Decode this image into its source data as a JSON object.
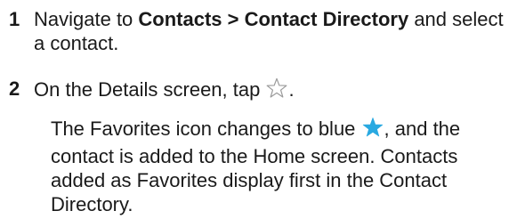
{
  "steps": [
    {
      "number": "1",
      "text_before": "Navigate to ",
      "bold_text": "Contacts > Contact Directory",
      "text_after": " and select a contact."
    },
    {
      "number": "2",
      "text_before": "On the Details screen, tap ",
      "text_after": "."
    }
  ],
  "note": {
    "text_before": "The Favorites icon changes to blue ",
    "text_after": ", and the contact is added to the Home screen. Contacts added as Favorites display first in the Contact Directory."
  },
  "icons": {
    "favorite_outline": "star-outline-icon",
    "favorite_filled": "star-filled-icon"
  },
  "colors": {
    "favorite_blue": "#29a9e1",
    "outline_gray": "#9a9a9a"
  }
}
